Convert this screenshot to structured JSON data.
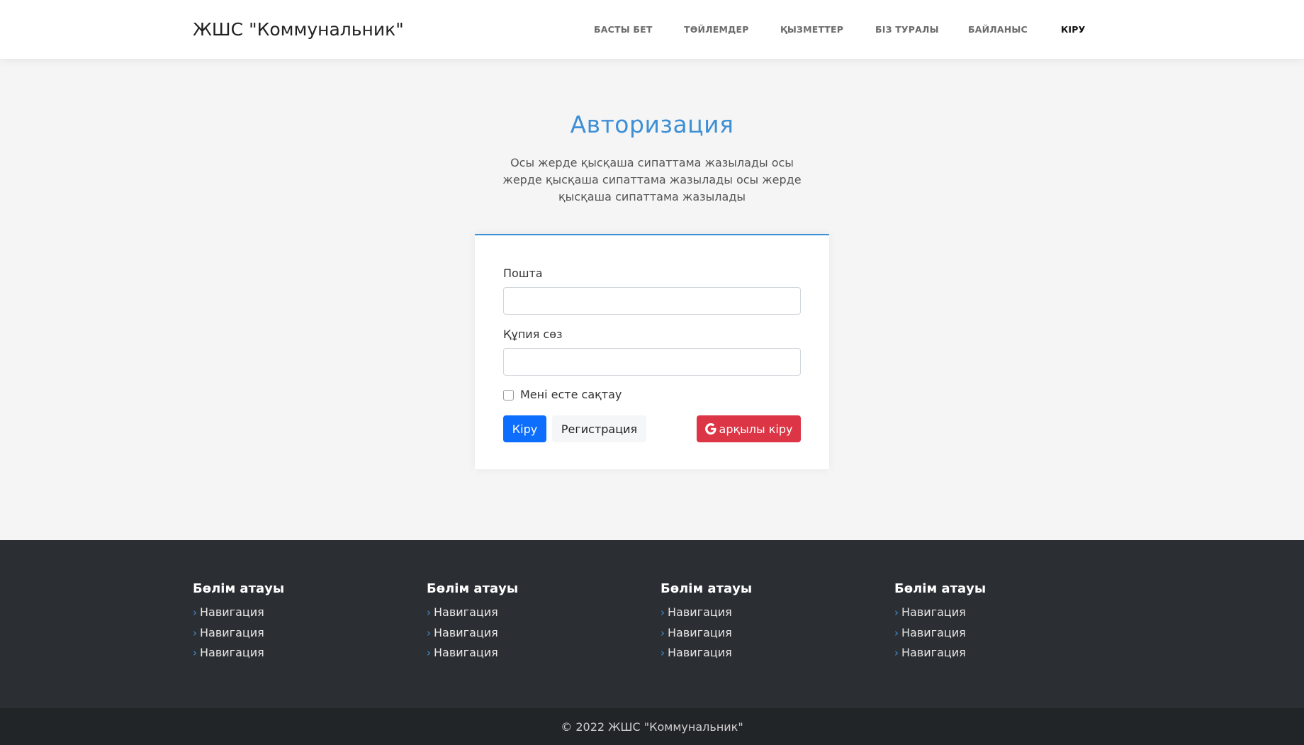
{
  "header": {
    "logo": "ЖШС \"Коммунальник\"",
    "nav": [
      {
        "label": "БАСТЫ БЕТ"
      },
      {
        "label": "ТӨЙЛЕМДЕР"
      },
      {
        "label": "ҚЫЗМЕТТЕР"
      },
      {
        "label": "БІЗ ТУРАЛЫ"
      },
      {
        "label": "БАЙЛАНЫС"
      },
      {
        "label": "КІРУ",
        "active": true
      }
    ]
  },
  "main": {
    "title": "Авторизация",
    "description": "Осы жерде қысқаша сипаттама жазылады осы жерде қысқаша сипаттама жазылады осы жерде қысқаша сипаттама жазылады"
  },
  "form": {
    "email_label": "Пошта",
    "email_value": "",
    "password_label": "Құпия сөз",
    "password_value": "",
    "remember_label": "Мені есте сақтау",
    "remember_checked": false,
    "login_button": "Кіру",
    "register_button": "Регистрация",
    "google_button": "арқылы кіру"
  },
  "footer": {
    "columns": [
      {
        "title": "Бөлім атауы",
        "links": [
          "Навигация",
          "Навигация",
          "Навигация"
        ]
      },
      {
        "title": "Бөлім атауы",
        "links": [
          "Навигация",
          "Навигация",
          "Навигация"
        ]
      },
      {
        "title": "Бөлім атауы",
        "links": [
          "Навигация",
          "Навигация",
          "Навигация"
        ]
      },
      {
        "title": "Бөлім атауы",
        "links": [
          "Навигация",
          "Навигация",
          "Навигация"
        ]
      }
    ],
    "copyright": "© 2022 ЖШС \"Коммунальник\""
  },
  "colors": {
    "accent": "#3d8fd6",
    "primary_button": "#0d6efd",
    "google_button": "#dc3545",
    "footer_bg": "#2b2f33",
    "copyright_bg": "#222528"
  }
}
